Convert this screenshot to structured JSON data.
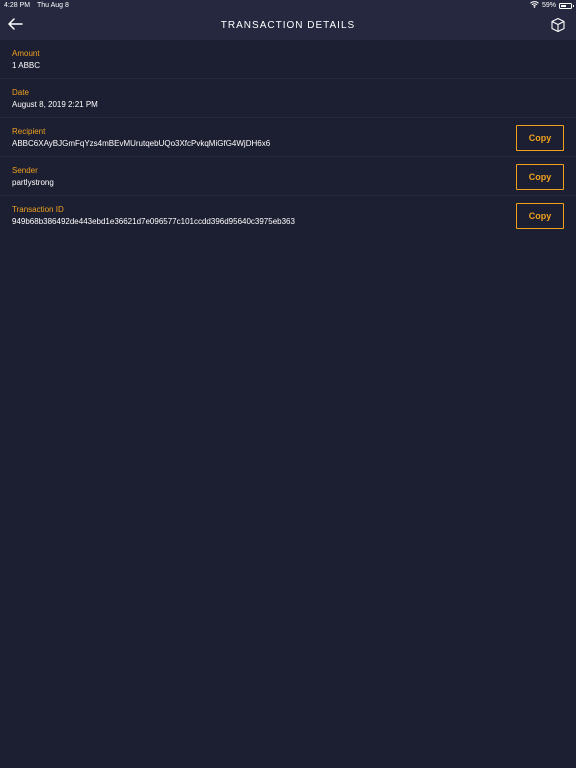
{
  "status_bar": {
    "time": "4:28 PM",
    "date": "Thu Aug 8",
    "battery": "59%",
    "battery_level": 0.59
  },
  "navbar": {
    "title": "TRANSACTION DETAILS",
    "back_icon": "arrow-left-icon",
    "right_icon": "cube-icon"
  },
  "colors": {
    "background": "#1c1e31",
    "navbar": "#25283f",
    "accent": "#f0a21f",
    "text": "#ffffff"
  },
  "fields": {
    "amount": {
      "label": "Amount",
      "value": "1 ABBC"
    },
    "date": {
      "label": "Date",
      "value": "August 8, 2019 2:21 PM"
    },
    "recipient": {
      "label": "Recipient",
      "value": "ABBC6XAyBJGmFqYzs4mBEvMUrutqebUQo3XfcPvkqMiGfG4WjDH6x6",
      "copy_label": "Copy"
    },
    "sender": {
      "label": "Sender",
      "value": "partlystrong",
      "copy_label": "Copy"
    },
    "transaction_id": {
      "label": "Transaction ID",
      "value": "949b68b386492de443ebd1e36621d7e096577c101ccdd396d95640c3975eb363",
      "copy_label": "Copy"
    }
  }
}
